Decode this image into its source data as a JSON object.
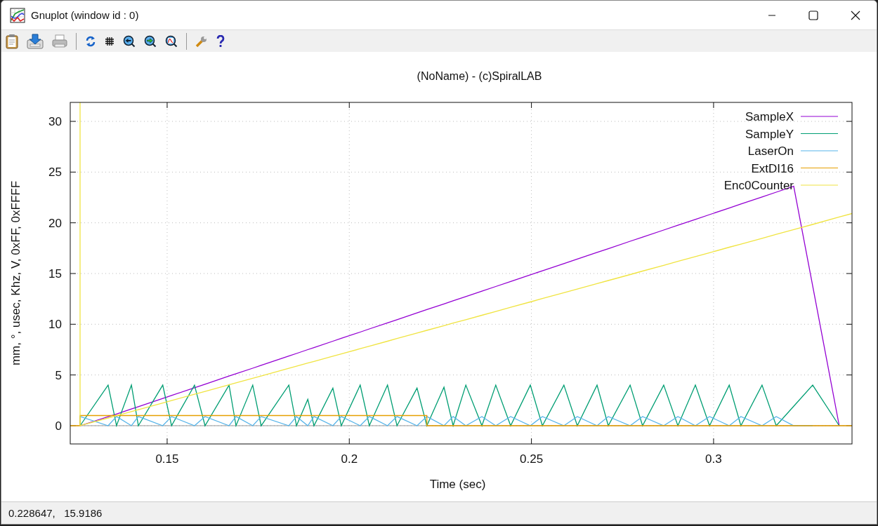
{
  "window": {
    "title": "Gnuplot (window id : 0)"
  },
  "plot": {
    "chart_data": {
      "type": "line",
      "title": "(NoName) - (c)SpiralLAB",
      "xlabel": "Time (sec)",
      "ylabel": "mm, °, usec, Khz, V, 0xFF, 0xFFFF",
      "xlim": [
        0.1234,
        0.338
      ],
      "ylim": [
        -1.8,
        31.87
      ],
      "xticks": [
        0.15,
        0.2,
        0.25,
        0.3
      ],
      "yticks": [
        0,
        5,
        10,
        15,
        20,
        25,
        30
      ],
      "grid": true,
      "legend": true,
      "x": [
        0.1234,
        0.1261,
        0.1261,
        0.1338,
        0.1361,
        0.1402,
        0.1421,
        0.1488,
        0.1512,
        0.1575,
        0.1604,
        0.167,
        0.1689,
        0.1735,
        0.1758,
        0.1834,
        0.1855,
        0.1886,
        0.1903,
        0.1955,
        0.1978,
        0.203,
        0.2055,
        0.2105,
        0.2131,
        0.2186,
        0.2213,
        0.2213,
        0.226,
        0.2285,
        0.232,
        0.2364,
        0.2402,
        0.2443,
        0.2497,
        0.253,
        0.2589,
        0.2626,
        0.268,
        0.2711,
        0.2771,
        0.2805,
        0.2863,
        0.2902,
        0.295,
        0.2989,
        0.3043,
        0.3075,
        0.3133,
        0.3172,
        0.322,
        0.3272,
        0.3345,
        0.338
      ],
      "series": [
        {
          "name": "SampleX",
          "color": "#9400d3",
          "values": [
            null,
            0,
            0,
            0.88,
            1.15,
            1.65,
            1.88,
            2.69,
            2.98,
            3.74,
            4.09,
            4.89,
            5.12,
            5.67,
            5.95,
            6.87,
            7.12,
            7.5,
            7.7,
            8.33,
            8.61,
            9.23,
            9.54,
            10.14,
            10.45,
            11.12,
            11.45,
            11.45,
            12.01,
            12.31,
            12.73,
            13.26,
            13.72,
            14.22,
            14.87,
            15.27,
            15.98,
            16.43,
            17.08,
            17.45,
            18.18,
            18.59,
            19.29,
            19.76,
            20.34,
            20.81,
            21.46,
            21.85,
            22.55,
            23.02,
            23.6,
            13.78,
            0,
            null
          ]
        },
        {
          "name": "SampleY",
          "color": "#009e73",
          "values": [
            null,
            0,
            0,
            4,
            0,
            4,
            0,
            4,
            0,
            4,
            0,
            4,
            0,
            4,
            0,
            4,
            0,
            2.6,
            0,
            3.7,
            0,
            4,
            0,
            4,
            0,
            3.7,
            0,
            0,
            3.8,
            0,
            4,
            0,
            4,
            0,
            4,
            0,
            4,
            0,
            4,
            0,
            4,
            0,
            4,
            0,
            4,
            0,
            4,
            0,
            4,
            0,
            1.92,
            4,
            0,
            null
          ]
        },
        {
          "name": "LaserOn",
          "color": "#56b4e9",
          "values": [
            null,
            0,
            0.9,
            0,
            0.9,
            0,
            0.9,
            0,
            0.9,
            0,
            0.9,
            0,
            0.9,
            0,
            0.9,
            0,
            0.9,
            0,
            0.9,
            0,
            0.9,
            0,
            0.9,
            0,
            0.9,
            0,
            0.9,
            0.9,
            0,
            0.9,
            0,
            0.9,
            0,
            0.9,
            0,
            0.9,
            0,
            0.9,
            0,
            0.9,
            0,
            0.9,
            0,
            0.9,
            0,
            0.9,
            0,
            0.9,
            0,
            0.9,
            0,
            0,
            null,
            null
          ]
        },
        {
          "name": "ExtDI16",
          "color": "#e69f00",
          "values": [
            0,
            0,
            1,
            1,
            1,
            1,
            1,
            1,
            1,
            1,
            1,
            1,
            1,
            1,
            1,
            1,
            1,
            1,
            1,
            1,
            1,
            1,
            1,
            1,
            1,
            1,
            1,
            0,
            0,
            0,
            0,
            0,
            0,
            0,
            0,
            0,
            0,
            0,
            0,
            0,
            0,
            0,
            0,
            0,
            0,
            0,
            0,
            0,
            0,
            0,
            0,
            0,
            0,
            0
          ]
        },
        {
          "name": "Enc0Counter",
          "color": "#f0e442",
          "values": [
            null,
            31.87,
            0,
            0.76,
            0.99,
            1.39,
            1.58,
            2.24,
            2.48,
            3.1,
            3.38,
            4.03,
            4.22,
            4.68,
            4.9,
            5.65,
            5.86,
            6.17,
            6.34,
            6.85,
            7.08,
            7.59,
            7.84,
            8.33,
            8.59,
            9.13,
            9.4,
            9.4,
            9.86,
            10.11,
            10.45,
            10.89,
            11.26,
            11.67,
            12.2,
            12.53,
            13.11,
            13.47,
            14.01,
            14.31,
            14.9,
            15.24,
            15.81,
            16.2,
            16.67,
            17.05,
            17.59,
            17.9,
            18.47,
            18.86,
            19.33,
            19.84,
            20.57,
            20.91
          ]
        }
      ]
    }
  },
  "status_bar": {
    "text": "0.228647,   15.9186"
  }
}
